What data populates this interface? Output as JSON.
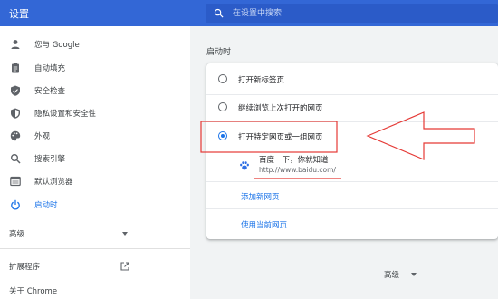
{
  "app": {
    "title": "设置"
  },
  "search": {
    "placeholder": "在设置中搜索"
  },
  "sidebar": {
    "items": [
      {
        "label": "您与 Google",
        "icon": "person-icon"
      },
      {
        "label": "自动填充",
        "icon": "clipboard-icon"
      },
      {
        "label": "安全检查",
        "icon": "shield-check-icon"
      },
      {
        "label": "隐私设置和安全性",
        "icon": "shield-icon"
      },
      {
        "label": "外观",
        "icon": "palette-icon"
      },
      {
        "label": "搜索引擎",
        "icon": "search-icon"
      },
      {
        "label": "默认浏览器",
        "icon": "browser-icon"
      },
      {
        "label": "启动时",
        "icon": "power-icon",
        "active": true
      }
    ],
    "advanced_label": "高级",
    "extensions_label": "扩展程序",
    "about_label": "关于 Chrome"
  },
  "startup": {
    "section_title": "启动时",
    "options": [
      {
        "label": "打开新标签页",
        "selected": false
      },
      {
        "label": "继续浏览上次打开的网页",
        "selected": false
      },
      {
        "label": "打开特定网页或一组网页",
        "selected": true
      }
    ],
    "pages": [
      {
        "title": "百度一下，你就知道",
        "url": "http://www.baidu.com/",
        "icon": "paw-icon"
      }
    ],
    "add_page_label": "添加新网页",
    "use_current_label": "使用当前网页"
  },
  "footer": {
    "advanced_label": "高级"
  },
  "colors": {
    "accent": "#1a73e8",
    "header": "#3367d6",
    "annotation": "#e53935"
  }
}
